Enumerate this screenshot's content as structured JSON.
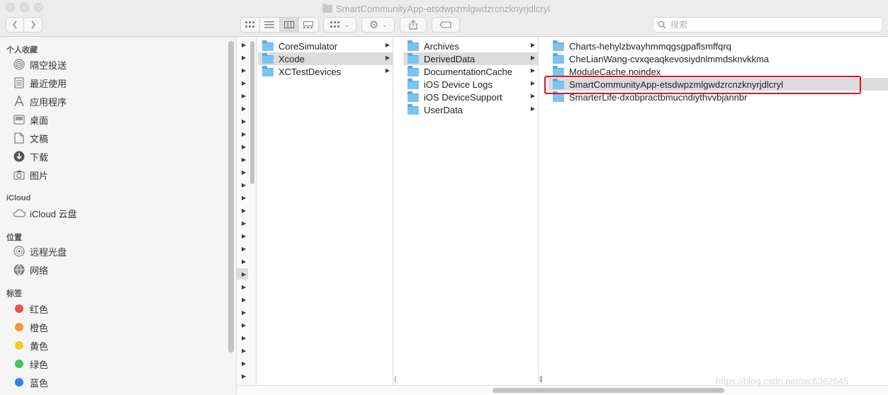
{
  "window": {
    "title": "SmartCommunityApp-etsdwpzmlgwdzrcnzknyrjdlcryl"
  },
  "toolbar": {
    "back_icon": "chevron-left",
    "forward_icon": "chevron-right",
    "view_modes": [
      "icon-view",
      "list-view",
      "column-view",
      "gallery-view"
    ],
    "active_view": "column-view",
    "group_icon": "grid-dropdown",
    "action_icon": "gear-dropdown",
    "share_icon": "share",
    "tag_icon": "tag",
    "search_placeholder": "搜索"
  },
  "sidebar": {
    "favorites_header": "个人收藏",
    "favorites": [
      {
        "label": "隔空投送",
        "icon": "airdrop-icon"
      },
      {
        "label": "最近使用",
        "icon": "recents-icon"
      },
      {
        "label": "应用程序",
        "icon": "applications-icon"
      },
      {
        "label": "桌面",
        "icon": "desktop-icon"
      },
      {
        "label": "文稿",
        "icon": "documents-icon"
      },
      {
        "label": "下载",
        "icon": "downloads-icon"
      },
      {
        "label": "图片",
        "icon": "pictures-icon"
      }
    ],
    "icloud_header": "iCloud",
    "icloud": [
      {
        "label": "iCloud 云盘",
        "icon": "cloud-icon"
      }
    ],
    "locations_header": "位置",
    "locations": [
      {
        "label": "远程光盘",
        "icon": "disc-icon"
      },
      {
        "label": "网络",
        "icon": "network-icon"
      }
    ],
    "tags_header": "标签",
    "tags": [
      {
        "label": "红色",
        "color": "#f0524c"
      },
      {
        "label": "橙色",
        "color": "#f3973a"
      },
      {
        "label": "黄色",
        "color": "#f5c732"
      },
      {
        "label": "绿色",
        "color": "#4ac058"
      },
      {
        "label": "蓝色",
        "color": "#2d82f2"
      }
    ]
  },
  "columns": {
    "col1": [
      {
        "name": "CoreSimulator",
        "selected": false
      },
      {
        "name": "Xcode",
        "selected": true
      },
      {
        "name": "XCTestDevices",
        "selected": false
      }
    ],
    "col2": [
      {
        "name": "Archives",
        "selected": false
      },
      {
        "name": "DerivedData",
        "selected": true
      },
      {
        "name": "DocumentationCache",
        "selected": false
      },
      {
        "name": "iOS Device Logs",
        "selected": false
      },
      {
        "name": "iOS DeviceSupport",
        "selected": false
      },
      {
        "name": "UserData",
        "selected": false
      }
    ],
    "col3": [
      {
        "name": "Charts-hehylzbvayhmmqgsgpaflsmffqrq",
        "selected": false
      },
      {
        "name": "CheLianWang-cvxqeaqkevosiydnlmmdsknvkkma",
        "selected": false
      },
      {
        "name": "ModuleCache.noindex",
        "selected": false
      },
      {
        "name": "SmartCommunityApp-etsdwpzmlgwdzrcnzknyrjdlcryl",
        "selected": true
      },
      {
        "name": "SmarterLife-dxobpractbmucndiythvvbjannbr",
        "selected": false
      }
    ]
  },
  "watermark": "https://blog.csdn.net/pjc6362645"
}
